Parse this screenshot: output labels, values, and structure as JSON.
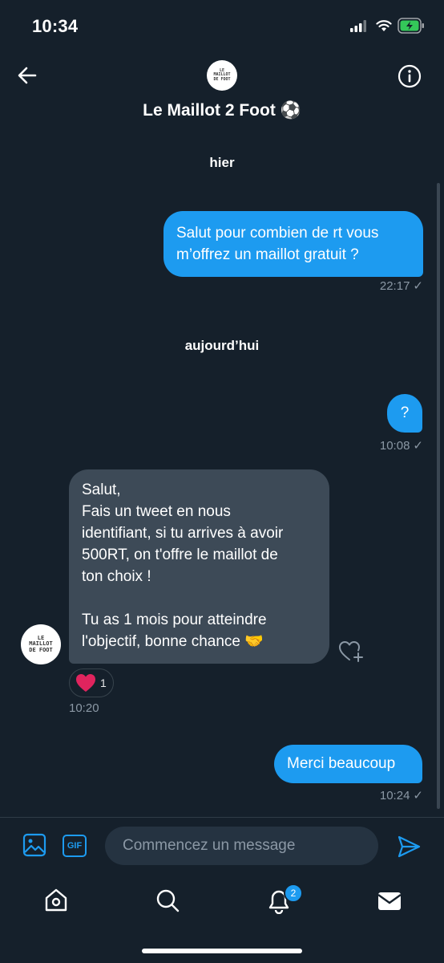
{
  "status_bar": {
    "time": "10:34"
  },
  "header": {
    "title": "Le Maillot 2 Foot ⚽️",
    "logo_lines": [
      "LE",
      "MAILLOT",
      "DE FOOT"
    ]
  },
  "messages": {
    "date_yesterday": "hier",
    "date_today": "aujourd’hui",
    "m1": {
      "text": "Salut pour combien de rt vous m’offrez un maillot gratuit ?",
      "time": "22:17"
    },
    "m2": {
      "text": "?",
      "time": "10:08"
    },
    "m3": {
      "text_lines": [
        "Salut,",
        "Fais un tweet en nous",
        "identifiant, si tu arrives à avoir",
        "500RT, on t'offre le maillot de",
        "ton choix !",
        "",
        "Tu as 1 mois pour atteindre",
        "l'objectif, bonne chance 🤝"
      ],
      "reaction_count": "1",
      "time": "10:20"
    },
    "m4": {
      "text": "Merci beaucoup",
      "time": "10:24"
    }
  },
  "composer": {
    "placeholder": "Commencez un message",
    "gif_label": "GIF"
  },
  "tabbar": {
    "notifications_badge": "2"
  },
  "colors": {
    "background": "#15202b",
    "accent": "#1d9bf0",
    "incoming_bubble": "#3d4a57"
  },
  "icons": [
    "back-arrow-icon",
    "info-icon",
    "image-icon",
    "gif-icon",
    "send-icon",
    "home-icon",
    "search-icon",
    "bell-icon",
    "mail-icon",
    "heart-icon",
    "add-reaction-icon"
  ]
}
